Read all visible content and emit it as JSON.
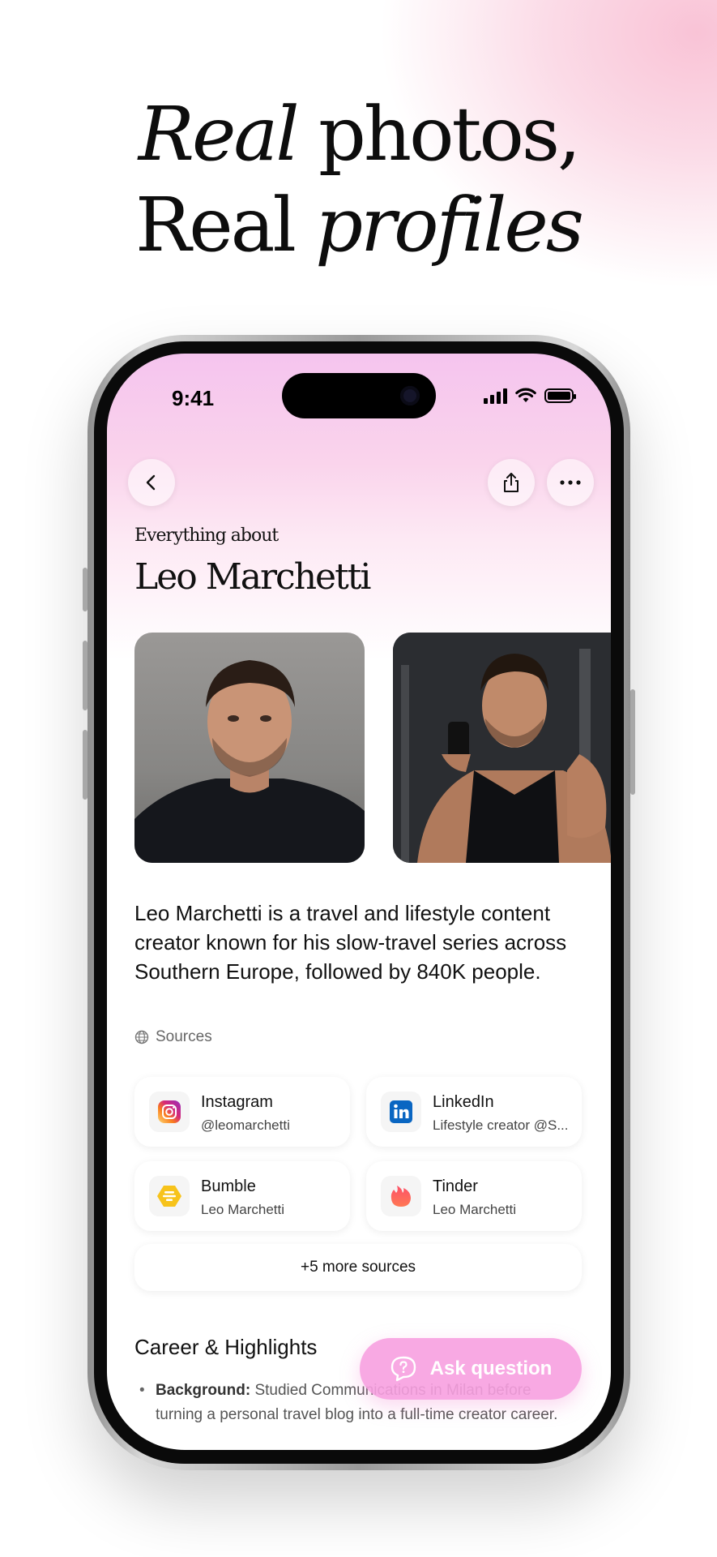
{
  "headline": {
    "line1_italic": "Real",
    "line1_rest": " photos,",
    "line2_regular": "Real ",
    "line2_italic": "profiles"
  },
  "status_bar": {
    "time": "9:41"
  },
  "header": {
    "eyebrow": "Everything about",
    "name": "Leo Marchetti"
  },
  "description": "Leo Marchetti is a travel and lifestyle content creator known for his slow-travel series across Southern Europe, followed by 840K people.",
  "sources": {
    "label": "Sources",
    "items": [
      {
        "name": "Instagram",
        "handle": "@leomarchetti",
        "icon": "instagram-icon"
      },
      {
        "name": "LinkedIn",
        "handle": "Lifestyle creator @S...",
        "icon": "linkedin-icon"
      },
      {
        "name": "Bumble",
        "handle": "Leo Marchetti",
        "icon": "bumble-icon"
      },
      {
        "name": "Tinder",
        "handle": "Leo Marchetti",
        "icon": "tinder-icon"
      }
    ],
    "more_label": "+5 more sources"
  },
  "career": {
    "title": "Career & Highlights",
    "bullets": [
      {
        "label": "Background:",
        "text": " Studied Communications in Milan before turning a personal travel blog into a full-time creator career."
      }
    ]
  },
  "ask_button": {
    "label": "Ask question"
  },
  "colors": {
    "accent_pink": "#f7a0e0",
    "instagram": "#e1306c",
    "linkedin": "#0a66c2",
    "bumble": "#f7c31b",
    "tinder": "#fd3a5e"
  }
}
